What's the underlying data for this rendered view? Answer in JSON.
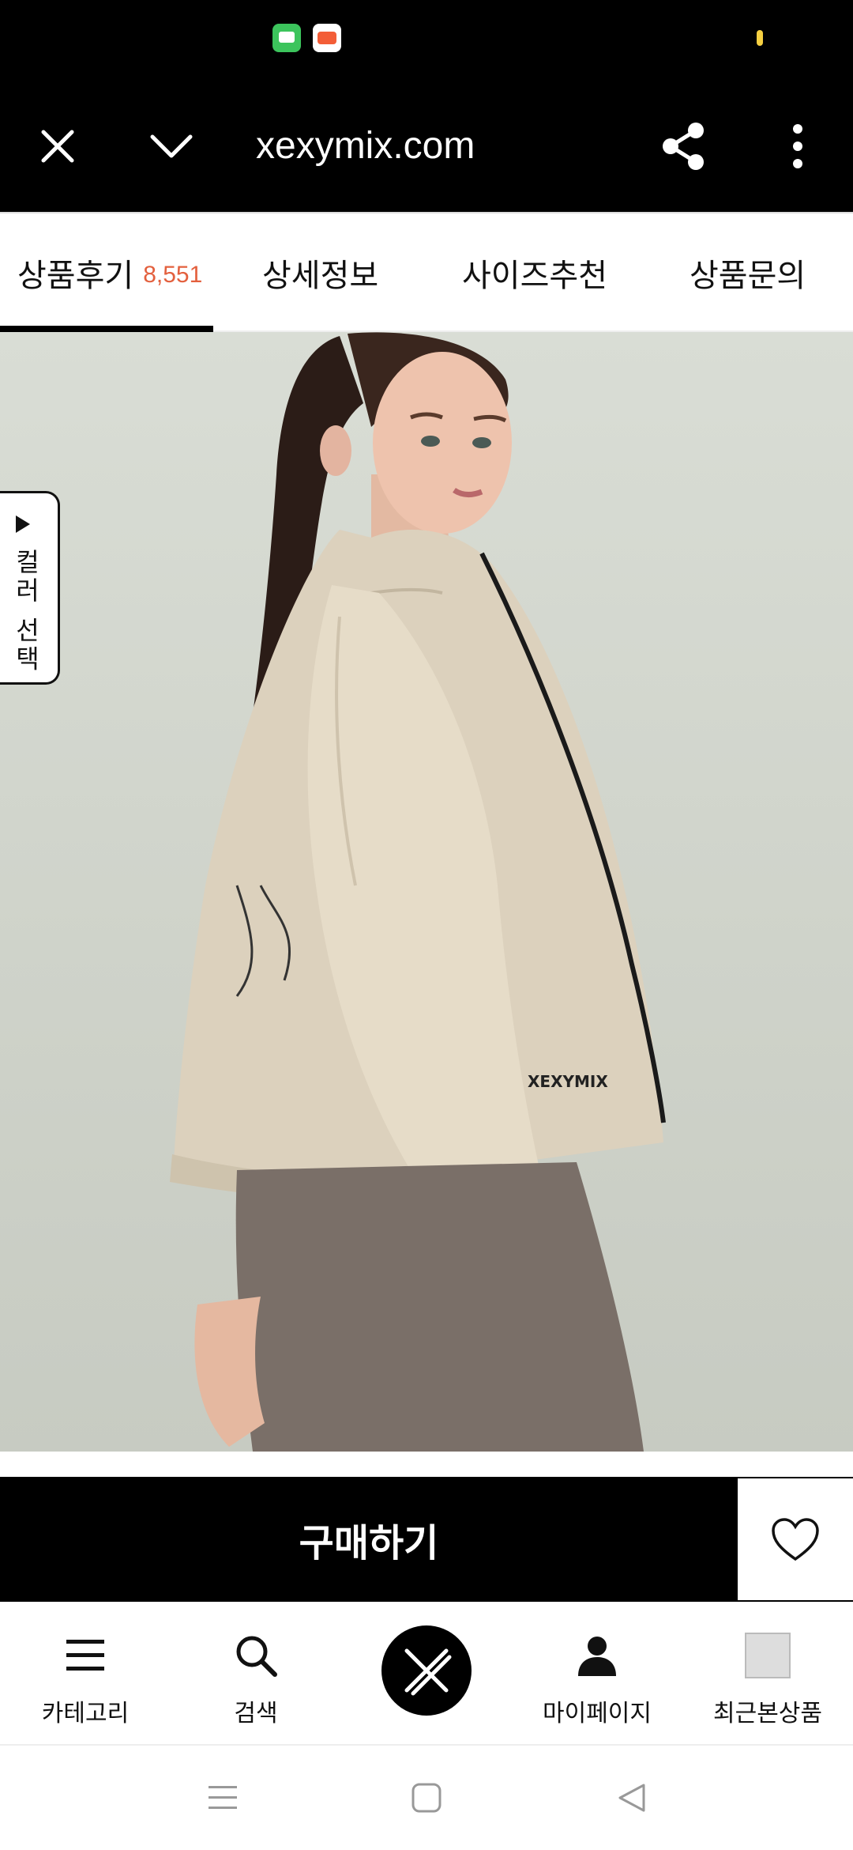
{
  "browser": {
    "url": "xexymix.com"
  },
  "tabs": [
    {
      "label": "상품후기",
      "count": "8,551",
      "active": true
    },
    {
      "label": "상세정보"
    },
    {
      "label": "사이즈추천"
    },
    {
      "label": "상품문의"
    }
  ],
  "product": {
    "color_select_label": "컬러 선택",
    "brand_print": "XEXYMIX"
  },
  "buy": {
    "label": "구매하기"
  },
  "bottom_nav": [
    {
      "label": "카테고리",
      "icon": "menu-icon"
    },
    {
      "label": "검색",
      "icon": "search-icon"
    },
    {
      "label": "",
      "icon": "xexymix-logo-icon"
    },
    {
      "label": "마이페이지",
      "icon": "person-icon"
    },
    {
      "label": "최근본상품",
      "icon": "recent-thumbnail"
    }
  ],
  "colors": {
    "accent": "#e3603e",
    "chat": "#f5a716",
    "bar": "#000000"
  }
}
